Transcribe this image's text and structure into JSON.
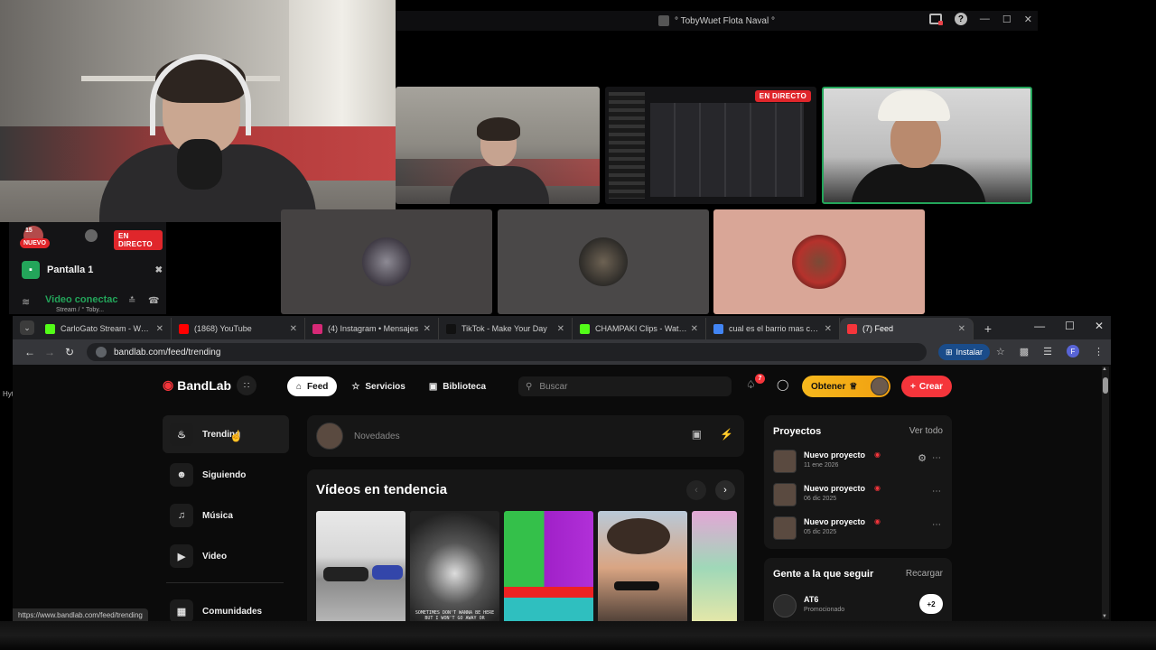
{
  "discord": {
    "window_title": "° TobyWuet Flota Naval °",
    "live_badge": "EN DIRECTO",
    "side_live_badge": "EN DIRECTO",
    "nuevo_badge": "NUEVO",
    "nuevo_count": "15",
    "screen_label": "Pantalla 1",
    "voice_title": "Video conectac",
    "voice_sub": "Stream / ° Toby...",
    "help_icon": "?"
  },
  "desktop_fragment": "Hyt",
  "browser": {
    "tabs": [
      {
        "label": "CarloGato Stream - Watch Li",
        "icon": "kick-icon",
        "color": "#53fc18"
      },
      {
        "label": "(1868) YouTube",
        "icon": "youtube-icon",
        "color": "#ff0000"
      },
      {
        "label": "(4) Instagram • Mensajes",
        "icon": "instagram-icon",
        "color": "#d62976"
      },
      {
        "label": "TikTok - Make Your Day",
        "icon": "tiktok-icon",
        "color": "#111111"
      },
      {
        "label": "CHAMPAKI Clips - Watch Liv",
        "icon": "kick-icon",
        "color": "#53fc18"
      },
      {
        "label": "cual es el barrio mas caro de",
        "icon": "google-icon",
        "color": "#4285f4"
      },
      {
        "label": "(7) Feed",
        "icon": "bandlab-icon",
        "color": "#f5353b"
      }
    ],
    "url": "bandlab.com/feed/trending",
    "install_label": "Instalar",
    "profile_initial": "F",
    "status_url": "https://www.bandlab.com/feed/trending"
  },
  "bandlab": {
    "logo": "BandLab",
    "nav": [
      {
        "label": "Feed",
        "icon": "home-icon"
      },
      {
        "label": "Servicios",
        "icon": "star-icon"
      },
      {
        "label": "Biblioteca",
        "icon": "library-icon"
      }
    ],
    "search_placeholder": "Buscar",
    "notification_count": "7",
    "obtener_label": "Obtener",
    "crear_label": "Crear",
    "sidebar": [
      {
        "label": "Trending",
        "icon": "flame-icon"
      },
      {
        "label": "Siguiendo",
        "icon": "people-icon"
      },
      {
        "label": "Música",
        "icon": "music-note-icon"
      },
      {
        "label": "Video",
        "icon": "video-icon"
      },
      {
        "label": "Comunidades",
        "icon": "communities-icon"
      }
    ],
    "composer_placeholder": "Novedades",
    "trending_title": "Vídeos en tendencia",
    "thumb2_caption_line1": "SOMETIMES DON'T WANNA BE HERE",
    "thumb2_caption_line2": "BUT I WON'T GO AWAY OR",
    "projects": {
      "title": "Proyectos",
      "link": "Ver todo",
      "items": [
        {
          "name": "Nuevo proyecto",
          "date": "11 ene 2026"
        },
        {
          "name": "Nuevo proyecto",
          "date": "06 dic 2025"
        },
        {
          "name": "Nuevo proyecto",
          "date": "05 dic 2025"
        }
      ]
    },
    "follow": {
      "title": "Gente a la que seguir",
      "link": "Recargar",
      "user_name": "AT6",
      "user_sub": "Promocionado",
      "add_label": "+2"
    }
  },
  "colors": {
    "bandlab_red": "#f5353b",
    "discord_green": "#23a55a",
    "obtener_gold": "#f6b81d"
  }
}
